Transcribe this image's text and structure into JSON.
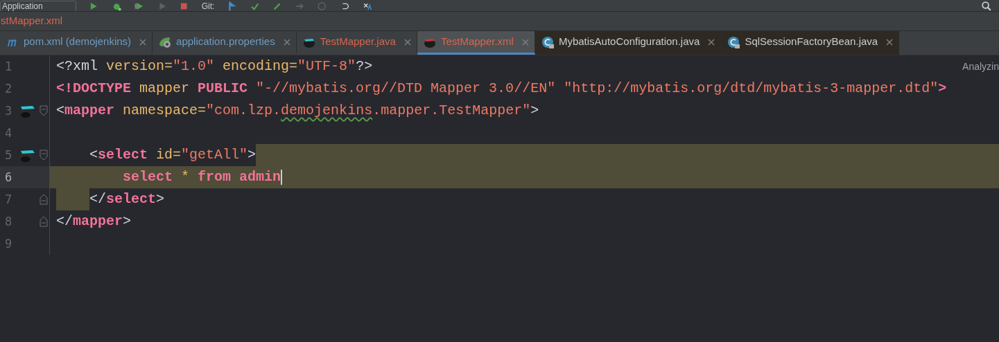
{
  "toolbar": {
    "run_config": "Application",
    "git_label": "Git:"
  },
  "breadcrumb": "stMapper.xml",
  "tabs": [
    {
      "label": "pom.xml (demojenkins)",
      "kind": "maven",
      "color": "#6d9cc4",
      "selected": false,
      "readonly": false
    },
    {
      "label": "application.properties",
      "kind": "spring",
      "color": "#6d9cc4",
      "selected": false,
      "readonly": false
    },
    {
      "label": "TestMapper.java",
      "kind": "mybatis",
      "color": "#d9654f",
      "selected": false,
      "readonly": false
    },
    {
      "label": "TestMapper.xml",
      "kind": "mybatisxml",
      "color": "#d9654f",
      "selected": true,
      "readonly": false
    },
    {
      "label": "MybatisAutoConfiguration.java",
      "kind": "class",
      "color": "#c9ccd0",
      "selected": false,
      "readonly": true
    },
    {
      "label": "SqlSessionFactoryBean.java",
      "kind": "class",
      "color": "#c9ccd0",
      "selected": false,
      "readonly": true
    }
  ],
  "status_hint": "Analyzin",
  "lines": [
    {
      "number": "1",
      "gutter_icon": false,
      "selected": false,
      "current": false,
      "tokens": [
        {
          "text": "<?xml ",
          "kind": "punct"
        },
        {
          "text": "version",
          "kind": "attr"
        },
        {
          "text": "=",
          "kind": "attr"
        },
        {
          "text": "\"1.0\"",
          "kind": "value"
        },
        {
          "text": " encoding",
          "kind": "attr"
        },
        {
          "text": "=",
          "kind": "attr"
        },
        {
          "text": "\"UTF-8\"",
          "kind": "value"
        },
        {
          "text": "?>",
          "kind": "punct"
        }
      ]
    },
    {
      "number": "2",
      "gutter_icon": false,
      "selected": false,
      "current": false,
      "tokens": [
        {
          "text": "<!DOCTYPE",
          "kind": "keyword"
        },
        {
          "text": " mapper ",
          "kind": "attr"
        },
        {
          "text": "PUBLIC",
          "kind": "keyword"
        },
        {
          "text": " \"-//mybatis.org//DTD Mapper 3.0//EN\" \"http://mybatis.org/dtd/mybatis-3-mapper.dtd\"",
          "kind": "value"
        },
        {
          "text": ">",
          "kind": "keyword"
        }
      ]
    },
    {
      "number": "3",
      "gutter_icon": true,
      "fold": {
        "kind": "open"
      },
      "selected": false,
      "current": false,
      "tokens": [
        {
          "text": "<",
          "kind": "punct"
        },
        {
          "text": "mapper",
          "kind": "tag"
        },
        {
          "text": " namespace",
          "kind": "attr"
        },
        {
          "text": "=",
          "kind": "attr"
        },
        {
          "text": "\"com.lzp.",
          "kind": "value"
        },
        {
          "text": "demojenkins",
          "kind": "typo"
        },
        {
          "text": ".mapper.TestMapper\"",
          "kind": "value"
        },
        {
          "text": ">",
          "kind": "punct"
        }
      ]
    },
    {
      "number": "4",
      "gutter_icon": false,
      "selected": false,
      "current": false
    },
    {
      "number": "5",
      "gutter_icon": true,
      "fold": {
        "kind": "open"
      },
      "selected": true,
      "current": false,
      "tokens": [
        {
          "text": "    <",
          "kind": "punct"
        },
        {
          "text": "select",
          "kind": "tag"
        },
        {
          "text": " id",
          "kind": "attr"
        },
        {
          "text": "=",
          "kind": "attr"
        },
        {
          "text": "\"getAll\"",
          "kind": "value"
        },
        {
          "text": ">",
          "kind": "punct"
        }
      ]
    },
    {
      "number": "6",
      "gutter_icon": false,
      "selected": true,
      "current": true,
      "tokens": [
        {
          "text": "        select",
          "kind": "tag"
        },
        {
          "text": " * ",
          "kind": "attr"
        },
        {
          "text": "from",
          "kind": "tag"
        },
        {
          "text": " admin",
          "kind": "tag"
        }
      ]
    },
    {
      "number": "7",
      "gutter_icon": false,
      "fold": {
        "kind": "close"
      },
      "selected": true,
      "current": false,
      "tokens": [
        {
          "text": "    </",
          "kind": "punct"
        },
        {
          "text": "select",
          "kind": "tag"
        },
        {
          "text": ">",
          "kind": "punct"
        }
      ]
    },
    {
      "number": "8",
      "gutter_icon": false,
      "fold": {
        "kind": "close"
      },
      "selected": false,
      "current": false,
      "tokens": [
        {
          "text": "</",
          "kind": "punct"
        },
        {
          "text": "mapper",
          "kind": "tag"
        },
        {
          "text": ">",
          "kind": "punct"
        }
      ]
    },
    {
      "number": "9",
      "gutter_icon": false,
      "selected": false,
      "current": false
    }
  ]
}
